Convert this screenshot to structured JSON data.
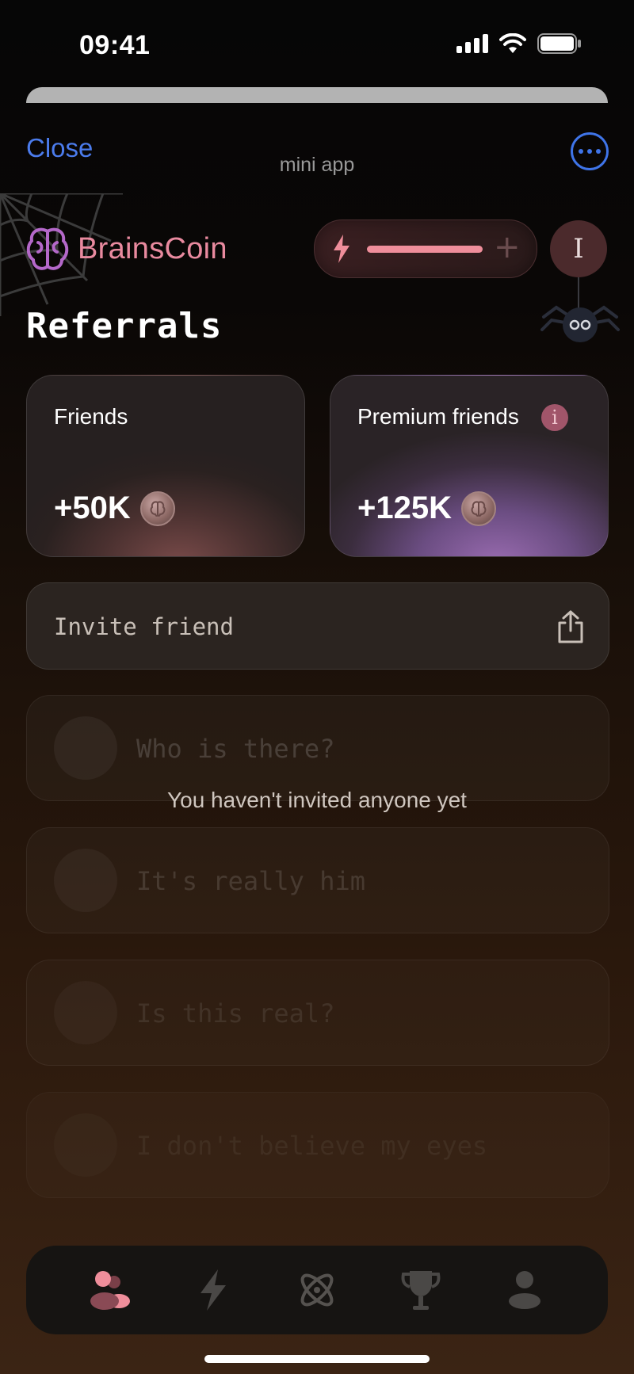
{
  "status_bar": {
    "time": "09:41"
  },
  "topbar": {
    "close_label": "Close",
    "title": "mini app"
  },
  "header": {
    "logo_text": "BrainsCoin",
    "energy_level": 0.75,
    "avatar_initial": "I"
  },
  "page_title": "Referrals",
  "cards": [
    {
      "label": "Friends",
      "value": "+50K"
    },
    {
      "label": "Premium friends",
      "value": "+125K",
      "info": "i"
    }
  ],
  "invite": {
    "label": "Invite friend"
  },
  "empty_state": {
    "message": "You haven't invited anyone yet",
    "placeholders": [
      "Who is there?",
      "It's really him",
      "Is this real?",
      "I don't believe my eyes"
    ]
  },
  "nav": {
    "items": [
      "friends-icon",
      "bolt-icon",
      "atom-icon",
      "trophy-icon",
      "profile-icon"
    ],
    "active": "friends-icon"
  },
  "colors": {
    "accent": "#ef8e9b",
    "link": "#4b7bec",
    "logo_purple": "#b468c9"
  }
}
